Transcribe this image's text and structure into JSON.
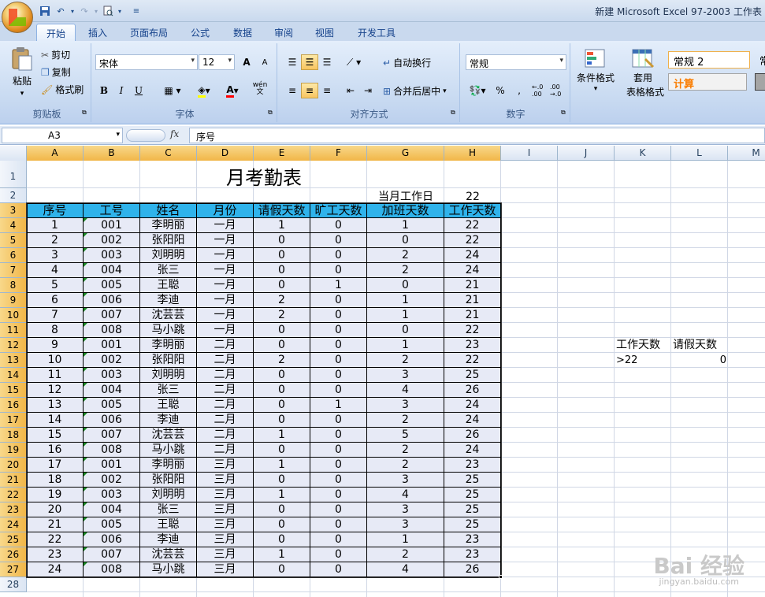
{
  "window": {
    "title": "新建 Microsoft Excel 97-2003 工作表"
  },
  "tabs": [
    "开始",
    "插入",
    "页面布局",
    "公式",
    "数据",
    "审阅",
    "视图",
    "开发工具"
  ],
  "ribbon": {
    "clipboard": {
      "paste": "粘贴",
      "cut": "剪切",
      "copy": "复制",
      "format_painter": "格式刷",
      "label": "剪贴板"
    },
    "font": {
      "name": "宋体",
      "size": "12",
      "bold": "B",
      "italic": "I",
      "underline": "U",
      "label": "字体",
      "grow": "A",
      "wen": "wén\n文"
    },
    "alignment": {
      "wrap": "自动换行",
      "merge": "合并后居中",
      "label": "对齐方式"
    },
    "number": {
      "format": "常规",
      "percent": "%",
      "comma": ",",
      "label": "数字",
      "inc": "←.0 .00",
      "dec": ".00 →.0"
    },
    "styles": {
      "conditional": "条件格式",
      "table": "套用",
      "table2": "表格格式",
      "style1": "常规 2",
      "style2": "计算",
      "style3": "常"
    }
  },
  "formula_bar": {
    "name_box": "A3",
    "fx": "fx",
    "formula": "序号"
  },
  "columns": [
    "A",
    "B",
    "C",
    "D",
    "E",
    "F",
    "G",
    "H",
    "I",
    "J",
    "K",
    "L",
    "M"
  ],
  "rows": [
    "1",
    "2",
    "3",
    "4",
    "5",
    "6",
    "7",
    "8",
    "9",
    "10",
    "11",
    "12",
    "13",
    "14",
    "15",
    "16",
    "17",
    "18",
    "19",
    "20",
    "21",
    "22",
    "23",
    "24",
    "25",
    "26",
    "27",
    "28"
  ],
  "sheet": {
    "title": "月考勤表",
    "workday_label": "当月工作日",
    "workday_value": "22",
    "headers": [
      "序号",
      "工号",
      "姓名",
      "月份",
      "请假天数",
      "旷工天数",
      "加班天数",
      "工作天数"
    ],
    "data": [
      [
        "1",
        "001",
        "李明丽",
        "一月",
        "1",
        "0",
        "1",
        "22"
      ],
      [
        "2",
        "002",
        "张阳阳",
        "一月",
        "0",
        "0",
        "0",
        "22"
      ],
      [
        "3",
        "003",
        "刘明明",
        "一月",
        "0",
        "0",
        "2",
        "24"
      ],
      [
        "4",
        "004",
        "张三",
        "一月",
        "0",
        "0",
        "2",
        "24"
      ],
      [
        "5",
        "005",
        "王聪",
        "一月",
        "0",
        "1",
        "0",
        "21"
      ],
      [
        "6",
        "006",
        "李迪",
        "一月",
        "2",
        "0",
        "1",
        "21"
      ],
      [
        "7",
        "007",
        "沈芸芸",
        "一月",
        "2",
        "0",
        "1",
        "21"
      ],
      [
        "8",
        "008",
        "马小跳",
        "一月",
        "0",
        "0",
        "0",
        "22"
      ],
      [
        "9",
        "001",
        "李明丽",
        "二月",
        "0",
        "0",
        "1",
        "23"
      ],
      [
        "10",
        "002",
        "张阳阳",
        "二月",
        "2",
        "0",
        "2",
        "22"
      ],
      [
        "11",
        "003",
        "刘明明",
        "二月",
        "0",
        "0",
        "3",
        "25"
      ],
      [
        "12",
        "004",
        "张三",
        "二月",
        "0",
        "0",
        "4",
        "26"
      ],
      [
        "13",
        "005",
        "王聪",
        "二月",
        "0",
        "1",
        "3",
        "24"
      ],
      [
        "14",
        "006",
        "李迪",
        "二月",
        "0",
        "0",
        "2",
        "24"
      ],
      [
        "15",
        "007",
        "沈芸芸",
        "二月",
        "1",
        "0",
        "5",
        "26"
      ],
      [
        "16",
        "008",
        "马小跳",
        "二月",
        "0",
        "0",
        "2",
        "24"
      ],
      [
        "17",
        "001",
        "李明丽",
        "三月",
        "1",
        "0",
        "2",
        "23"
      ],
      [
        "18",
        "002",
        "张阳阳",
        "三月",
        "0",
        "0",
        "3",
        "25"
      ],
      [
        "19",
        "003",
        "刘明明",
        "三月",
        "1",
        "0",
        "4",
        "25"
      ],
      [
        "20",
        "004",
        "张三",
        "三月",
        "0",
        "0",
        "3",
        "25"
      ],
      [
        "21",
        "005",
        "王聪",
        "三月",
        "0",
        "0",
        "3",
        "25"
      ],
      [
        "22",
        "006",
        "李迪",
        "三月",
        "0",
        "0",
        "1",
        "23"
      ],
      [
        "23",
        "007",
        "沈芸芸",
        "三月",
        "1",
        "0",
        "2",
        "23"
      ],
      [
        "24",
        "008",
        "马小跳",
        "三月",
        "0",
        "0",
        "4",
        "26"
      ]
    ],
    "criteria": {
      "h1": "工作天数",
      "h2": "请假天数",
      "v1": ">22",
      "v2": "0"
    }
  },
  "watermark": {
    "brand": "Bai 经验",
    "url": "jingyan.baidu.com"
  }
}
